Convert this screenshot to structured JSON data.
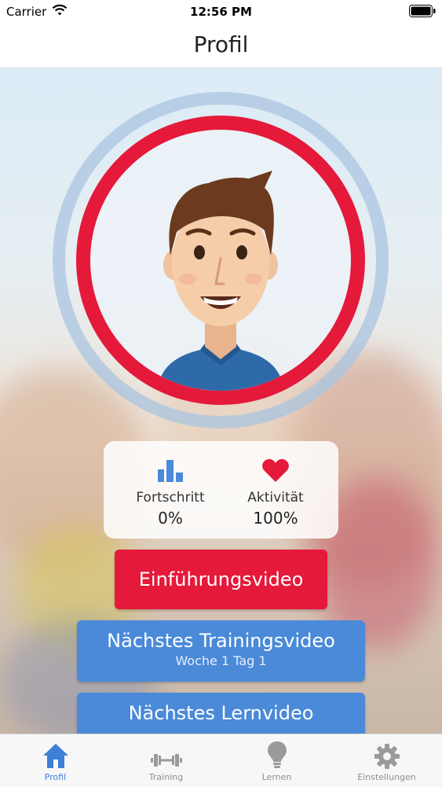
{
  "status_bar": {
    "carrier": "Carrier",
    "time": "12:56 PM"
  },
  "nav": {
    "title": "Profil"
  },
  "stats": [
    {
      "label": "Fortschritt",
      "value": "0%",
      "icon": "bar-chart-icon"
    },
    {
      "label": "Aktivität",
      "value": "100%",
      "icon": "heart-icon"
    }
  ],
  "buttons": {
    "intro_video": "Einführungsvideo",
    "training_video": {
      "title": "Nächstes Trainingsvideo",
      "subtitle": "Woche 1 Tag 1"
    },
    "learn_video": {
      "title": "Nächstes Lernvideo",
      "subtitle": ""
    }
  },
  "tabs": [
    {
      "label": "Profil",
      "icon": "home-icon",
      "active": true
    },
    {
      "label": "Training",
      "icon": "dumbbell-icon",
      "active": false
    },
    {
      "label": "Lernen",
      "icon": "lightbulb-icon",
      "active": false
    },
    {
      "label": "Einstellungen",
      "icon": "gear-icon",
      "active": false
    }
  ],
  "colors": {
    "accent_red": "#e5193a",
    "accent_blue": "#4a8ad9",
    "tab_active": "#3d80d6",
    "tab_inactive": "#8e8e8e"
  }
}
